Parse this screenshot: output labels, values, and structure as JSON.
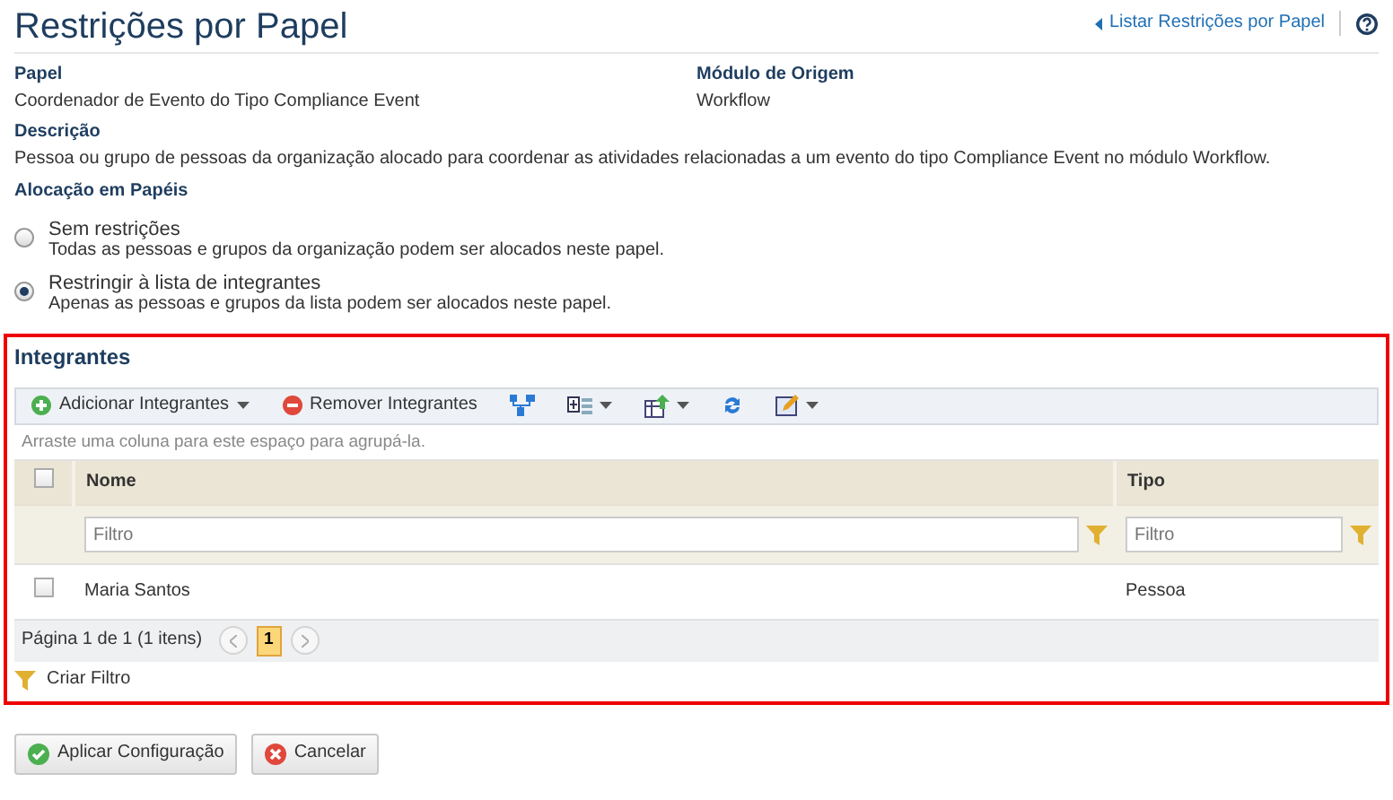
{
  "title": "Restrições por Papel",
  "back_link": "Listar Restrições por Papel",
  "fields": [
    {
      "label": "Papel",
      "value": "Coordenador de Evento do Tipo Compliance Event"
    },
    {
      "label": "Módulo de Origem",
      "value": "Workflow"
    }
  ],
  "description": {
    "label": "Descrição",
    "value": "Pessoa ou grupo de pessoas da organização alocado para coordenar as atividades relacionadas a um evento do tipo Compliance Event no módulo Workflow."
  },
  "allocation": {
    "label": "Alocação em Papéis",
    "options": [
      {
        "title": "Sem restrições",
        "hint": "Todas as pessoas e grupos da organização podem ser alocados neste papel.",
        "selected": false
      },
      {
        "title": "Restringir à lista de integrantes",
        "hint": "Apenas as pessoas e grupos da lista podem ser alocados neste papel.",
        "selected": true
      }
    ]
  },
  "members": {
    "title": "Integrantes",
    "toolbar": [
      {
        "kind": "add",
        "label": "Adicionar Integrantes",
        "dropdown": true
      },
      {
        "kind": "remove",
        "label": "Remover Integrantes",
        "dropdown": false
      },
      {
        "kind": "hierarchy",
        "dropdown": false
      },
      {
        "kind": "columns",
        "dropdown": true
      },
      {
        "kind": "export",
        "dropdown": true
      },
      {
        "kind": "refresh",
        "dropdown": false
      },
      {
        "kind": "edit",
        "dropdown": true
      }
    ],
    "group_hint": "Arraste uma coluna para este espaço para agrupá-la.",
    "select_all_checked": false,
    "columns": [
      {
        "label": "Nome",
        "filter_placeholder": "Filtro"
      },
      {
        "label": "Tipo",
        "filter_placeholder": "Filtro"
      }
    ],
    "rows": [
      {
        "checked": false,
        "cells": [
          "Maria Santos",
          "Pessoa"
        ]
      }
    ],
    "pager": {
      "summary": "Página 1 de 1 (1 itens)",
      "pages": [
        {
          "label": "1",
          "selected": true
        }
      ]
    },
    "create_filter": "Criar Filtro"
  },
  "buttons": [
    {
      "kind": "apply",
      "label": "Aplicar Configuração"
    },
    {
      "kind": "cancel",
      "label": "Cancelar"
    }
  ]
}
